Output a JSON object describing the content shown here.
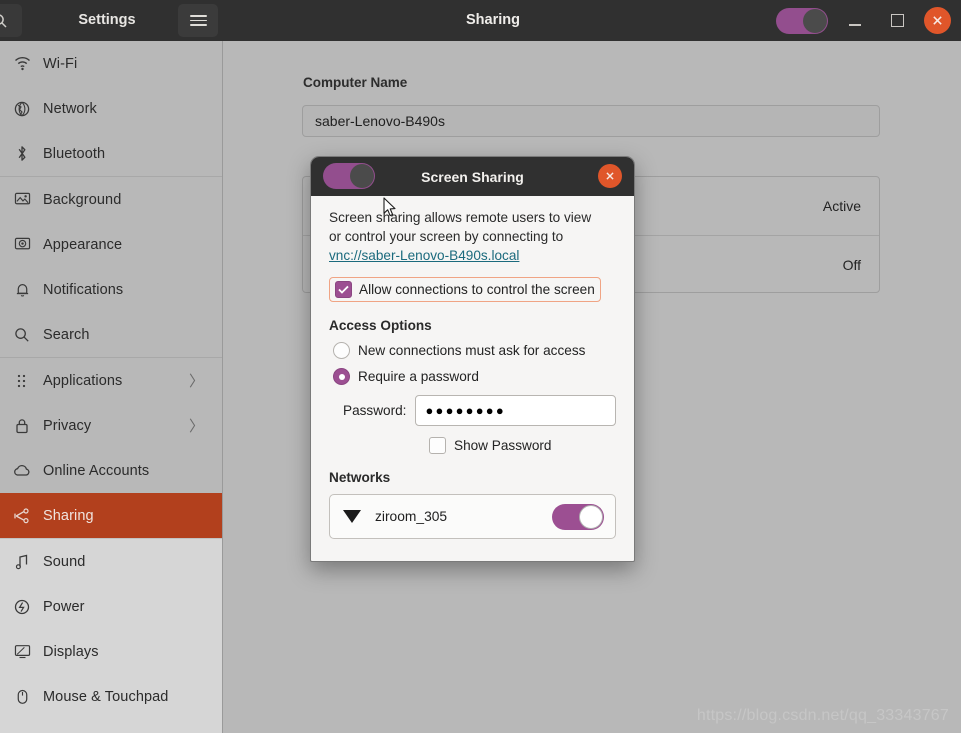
{
  "window": {
    "title_left": "Settings",
    "title_center": "Sharing",
    "search_icon": "search-icon",
    "menu_icon": "hamburger-menu-icon",
    "minimize_label": "–",
    "maximize_label": "□",
    "close_label": "✕",
    "header_toggle_state": "on"
  },
  "sidebar": {
    "items": [
      {
        "label": "Wi-Fi",
        "icon": "wifi-icon",
        "chevron": "",
        "selected": false
      },
      {
        "label": "Network",
        "icon": "network-icon",
        "chevron": "",
        "selected": false
      },
      {
        "label": "Bluetooth",
        "icon": "bluetooth-icon",
        "chevron": "",
        "selected": false
      },
      {
        "label": "Background",
        "icon": "background-icon",
        "chevron": "",
        "selected": false
      },
      {
        "label": "Appearance",
        "icon": "appearance-icon",
        "chevron": "",
        "selected": false
      },
      {
        "label": "Notifications",
        "icon": "bell-icon",
        "chevron": "",
        "selected": false
      },
      {
        "label": "Search",
        "icon": "search-icon",
        "chevron": "",
        "selected": false
      },
      {
        "label": "Applications",
        "icon": "applications-grid-icon",
        "chevron": "〉",
        "selected": false
      },
      {
        "label": "Privacy",
        "icon": "lock-icon",
        "chevron": "〉",
        "selected": false
      },
      {
        "label": "Online Accounts",
        "icon": "cloud-icon",
        "chevron": "",
        "selected": false
      },
      {
        "label": "Sharing",
        "icon": "share-nodes-icon",
        "chevron": "",
        "selected": true
      },
      {
        "label": "Sound",
        "icon": "sound-note-icon",
        "chevron": "",
        "selected": false
      },
      {
        "label": "Power",
        "icon": "power-icon",
        "chevron": "",
        "selected": false
      },
      {
        "label": "Displays",
        "icon": "displays-icon",
        "chevron": "",
        "selected": false
      },
      {
        "label": "Mouse & Touchpad",
        "icon": "mouse-icon",
        "chevron": "",
        "selected": false
      }
    ]
  },
  "main": {
    "computer_name_label": "Computer Name",
    "computer_name_value": "saber-Lenovo-B490s",
    "rows": [
      {
        "status": "Active"
      },
      {
        "status": "Off"
      }
    ],
    "watermark": "https://blog.csdn.net/qq_33343767"
  },
  "dialog": {
    "title": "Screen Sharing",
    "toggle_state": "on",
    "close_label": "✕",
    "description_line1": "Screen sharing allows remote users to view",
    "description_line2": "or control your screen by connecting to",
    "link": "vnc://saber-Lenovo-B490s.local",
    "allow_control_label": "Allow connections to control the screen",
    "allow_control_checked": true,
    "access_options_title": "Access Options",
    "radio_ask": "New connections must ask for access",
    "radio_password": "Require a password",
    "radio_selected": "require_password",
    "password_label": "Password:",
    "password_value": "●●●●●●●●",
    "show_password_label": "Show Password",
    "show_password_checked": false,
    "networks_title": "Networks",
    "networks": [
      {
        "name": "ziroom_305",
        "icon": "wifi-signal-icon",
        "toggle_state": "on"
      }
    ]
  },
  "colors": {
    "accent_orange": "#b2401d",
    "toggle_purple": "#9c4f92",
    "close_red": "#e0562a",
    "link_teal": "#1b6a7d",
    "focus_ring": "#f0a484",
    "titlebar_dark": "#303030"
  }
}
